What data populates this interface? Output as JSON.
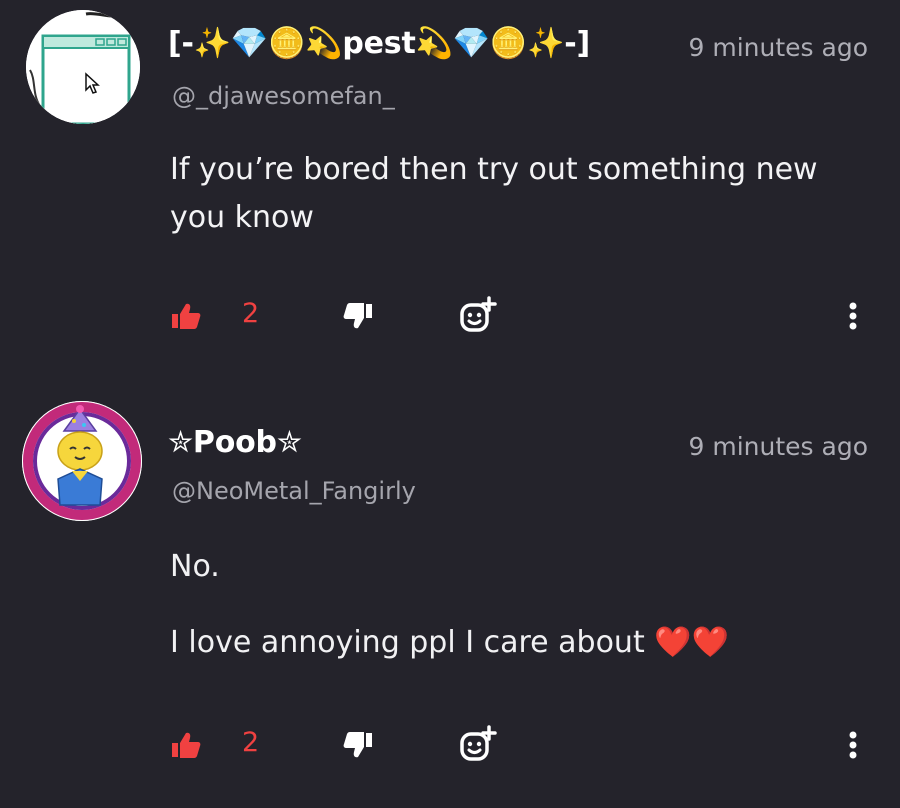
{
  "comments": [
    {
      "display_name": "[-✨💎🪙💫pest💫💎🪙✨-]",
      "handle": "@_djawesomefan_",
      "time": "9 minutes ago",
      "body": "If you’re bored then try out something new you know",
      "likes": "2"
    },
    {
      "display_name": "✮Poob✮",
      "handle": "@NeoMetal_Fangirly",
      "time": "9 minutes ago",
      "body_line1": "No.",
      "body_line2": "I love annoying ppl I care about ❤️❤️",
      "likes": "2"
    }
  ],
  "colors": {
    "background": "#24232b",
    "like_active": "#f04141",
    "muted_text": "#aeaeb6"
  },
  "icons": [
    "thumbs-up-icon",
    "thumbs-down-icon",
    "add-reaction-icon",
    "more-vertical-icon"
  ]
}
